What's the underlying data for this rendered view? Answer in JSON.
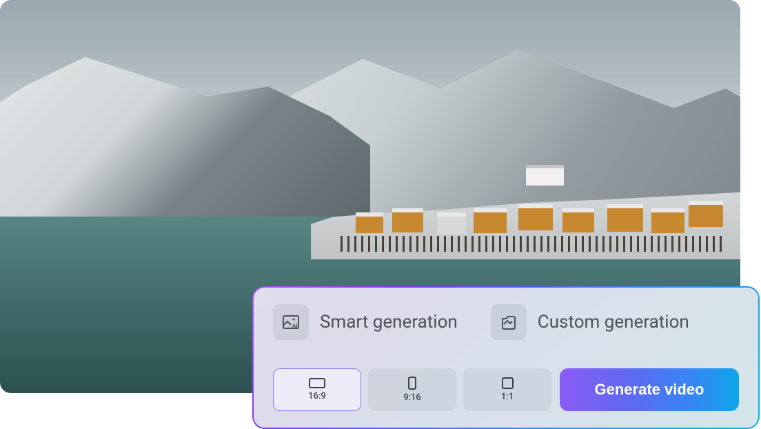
{
  "modes": {
    "smart": {
      "label": "Smart generation",
      "icon": "smart-generation-icon"
    },
    "custom": {
      "label": "Custom generation",
      "icon": "custom-generation-icon"
    }
  },
  "aspectRatios": [
    {
      "label": "16:9",
      "selected": true
    },
    {
      "label": "9:16",
      "selected": false
    },
    {
      "label": "1:1",
      "selected": false
    }
  ],
  "generateButton": {
    "label": "Generate video"
  },
  "colors": {
    "gradientStart": "#8b5cf6",
    "gradientEnd": "#0ea5e9",
    "selectedBorder": "#8b7ff5"
  }
}
